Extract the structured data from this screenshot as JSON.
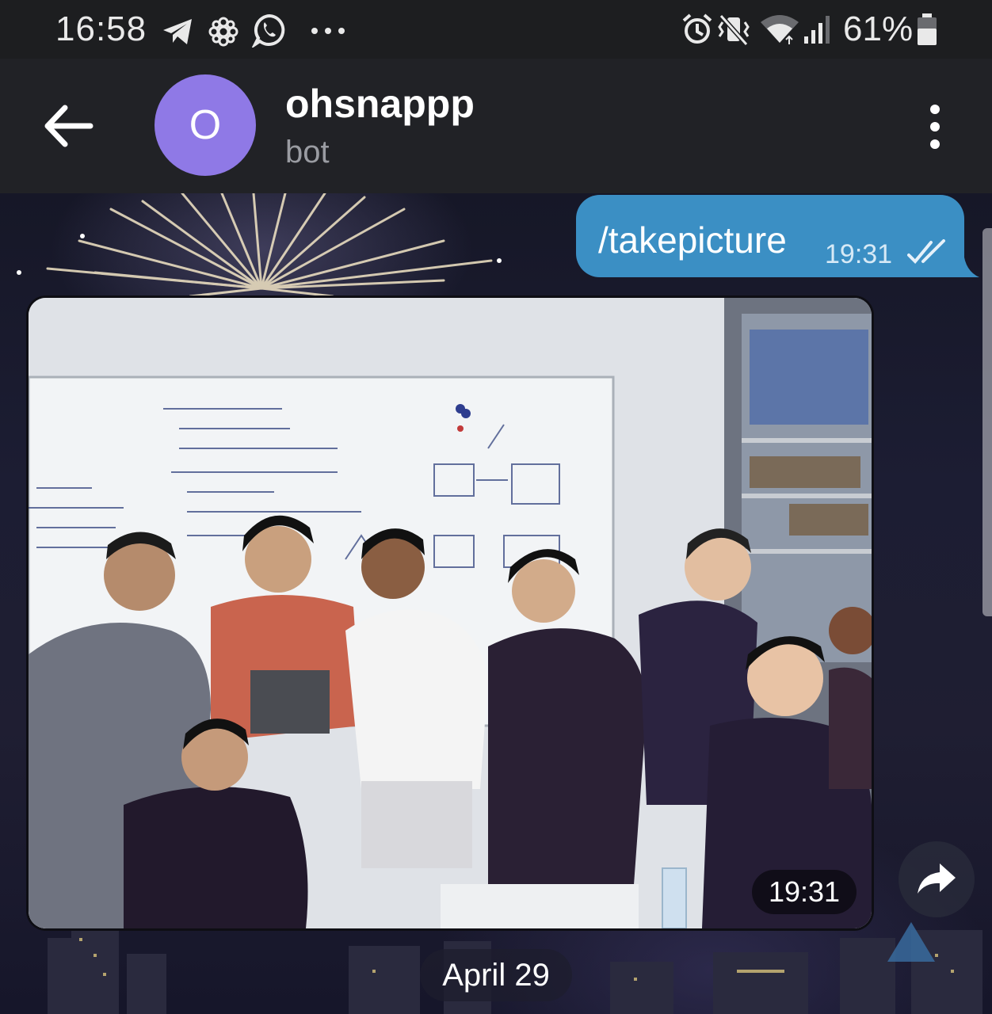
{
  "status_bar": {
    "time": "16:58",
    "battery": "61%",
    "icons": [
      "telegram-icon",
      "flower-app-icon",
      "whatsapp-icon",
      "more-notifications-icon",
      "alarm-icon",
      "vibrate-icon",
      "wifi-icon",
      "signal-icon",
      "battery-icon"
    ]
  },
  "header": {
    "avatar_letter": "O",
    "title": "ohsnappp",
    "subtitle": "bot",
    "avatar_color": "#8f79e6"
  },
  "messages": {
    "outgoing": {
      "text": "/takepicture",
      "time": "19:31",
      "status": "read",
      "bubble_color": "#3b8fc4"
    },
    "photo": {
      "time": "19:31"
    }
  },
  "date_separator": "April 29"
}
